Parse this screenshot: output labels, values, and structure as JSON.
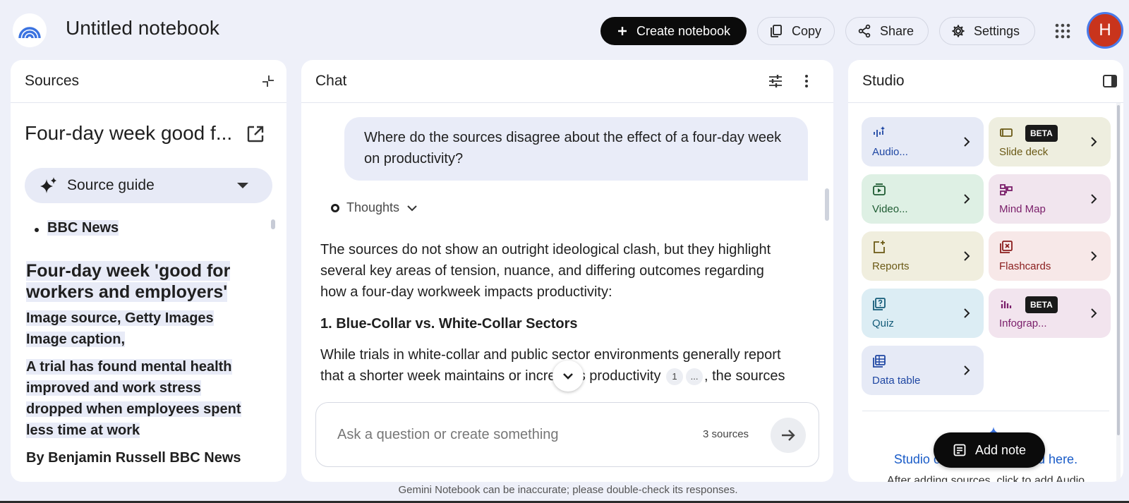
{
  "header": {
    "title": "Untitled notebook",
    "create_label": "Create notebook",
    "copy_label": "Copy",
    "share_label": "Share",
    "settings_label": "Settings",
    "avatar_initial": "H"
  },
  "sources": {
    "panel_title": "Sources",
    "source_title": "Four-day week good f...",
    "guide_label": "Source guide",
    "bullet": "BBC News",
    "headline": "Four-day week 'good for workers and employers'",
    "image_source": "Image source, Getty Images",
    "image_caption": "Image caption,",
    "summary": "A trial has found mental health improved and work stress dropped when employees spent less time at work",
    "byline": "By Benjamin Russell BBC News"
  },
  "chat": {
    "panel_title": "Chat",
    "user_message": "Where do the sources disagree about the effect of a four-day week on productivity?",
    "thoughts_label": "Thoughts",
    "answer_intro": "The sources do not show an outright ideological clash, but they highlight several key areas of tension, nuance, and differing outcomes regarding how a four-day workweek impacts productivity:",
    "section_heading": "1. Blue-Collar vs. White-Collar Sectors",
    "answer_body_a": "While trials in white-collar and public sector environments generally report that a shorter week maintains or increases productivity",
    "answer_body_b": ", the sources point out that some studies conclude that this is",
    "citation_1": "1",
    "citation_more": "...",
    "input_placeholder": "Ask a question or create something",
    "source_count": "3 sources"
  },
  "studio": {
    "panel_title": "Studio",
    "tiles": [
      {
        "label": "Audio...",
        "icon": "audio-waveform-icon",
        "bg": "#e6eaf6",
        "fg": "#1f47a3"
      },
      {
        "label": "Slide deck",
        "icon": "slides-icon",
        "bg": "#eeeedf",
        "fg": "#6b5a16",
        "badge": "BETA"
      },
      {
        "label": "Video...",
        "icon": "video-icon",
        "bg": "#def0e4",
        "fg": "#1f5c33"
      },
      {
        "label": "Mind Map",
        "icon": "mind-map-icon",
        "bg": "#f1e5ee",
        "fg": "#7a1e6a"
      },
      {
        "label": "Reports",
        "icon": "reports-icon",
        "bg": "#f0eede",
        "fg": "#6b5a16"
      },
      {
        "label": "Flashcards",
        "icon": "flashcards-icon",
        "bg": "#f7e8e8",
        "fg": "#8a1c1c"
      },
      {
        "label": "Quiz",
        "icon": "quiz-icon",
        "bg": "#dcedf4",
        "fg": "#145c79"
      },
      {
        "label": "Infograp...",
        "icon": "infographic-icon",
        "bg": "#f2e4ee",
        "fg": "#7a1e6a",
        "badge": "BETA"
      },
      {
        "label": "Data table",
        "icon": "data-table-icon",
        "bg": "#e6eaf6",
        "fg": "#1f47a3"
      }
    ],
    "empty_text": "Studio output will be saved here.",
    "empty_sub": "After adding sources, click to add Audio",
    "add_note_label": "Add note"
  },
  "footer": {
    "disclaimer": "Gemini Notebook can be inaccurate; please double-check its responses."
  }
}
